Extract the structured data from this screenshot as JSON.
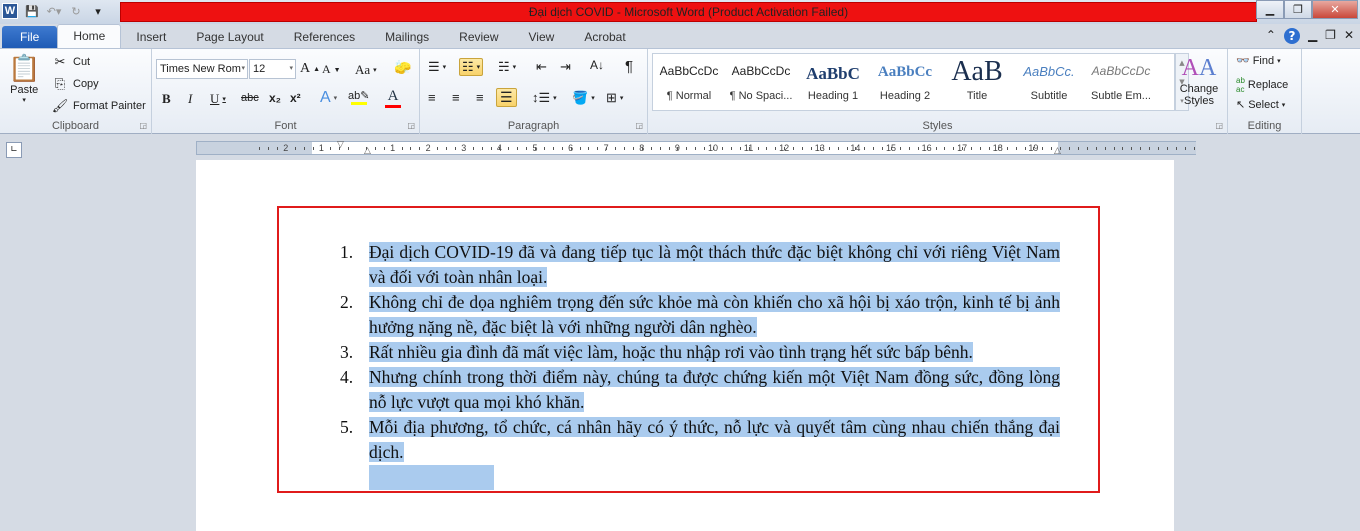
{
  "window": {
    "title": "Đại dịch COVID  -  Microsoft Word (Product Activation Failed)",
    "logo": "W"
  },
  "tabs": [
    "File",
    "Home",
    "Insert",
    "Page Layout",
    "References",
    "Mailings",
    "Review",
    "View",
    "Acrobat"
  ],
  "active_tab": "Home",
  "clipboard": {
    "label": "Clipboard",
    "paste": "Paste",
    "cut": "Cut",
    "copy": "Copy",
    "format_painter": "Format Painter"
  },
  "font": {
    "label": "Font",
    "name": "Times New Rom",
    "size": "12",
    "bold": "B",
    "italic": "I",
    "underline": "U",
    "strike": "abc",
    "sub": "x₂",
    "sup": "x²",
    "case": "Aa",
    "highlight_color": "#ffff00",
    "font_color": "#ff0000"
  },
  "paragraph": {
    "label": "Paragraph",
    "pilcrow": "¶"
  },
  "styles": {
    "label": "Styles",
    "items": [
      {
        "preview": "AaBbCcDc",
        "name": "¶ Normal"
      },
      {
        "preview": "AaBbCcDc",
        "name": "¶ No Spaci..."
      },
      {
        "preview": "AaBbC",
        "name": "Heading 1"
      },
      {
        "preview": "AaBbCc",
        "name": "Heading 2"
      },
      {
        "preview": "AaB",
        "name": "Title"
      },
      {
        "preview": "AaBbCc.",
        "name": "Subtitle"
      },
      {
        "preview": "AaBbCcDc",
        "name": "Subtle Em..."
      }
    ],
    "change_styles": "Change Styles"
  },
  "editing": {
    "label": "Editing",
    "find": "Find",
    "replace": "Replace",
    "select": "Select"
  },
  "ruler": {
    "labels": [
      "2",
      "1",
      "1",
      "2",
      "3",
      "4",
      "5",
      "6",
      "7",
      "8",
      "9",
      "10",
      "11",
      "12",
      "13",
      "14",
      "15",
      "16",
      "17",
      "18",
      "19"
    ]
  },
  "document": {
    "items": [
      {
        "num": "1.",
        "text": "Đại dịch COVID-19 đã và đang tiếp tục là một thách thức đặc biệt không chỉ với riêng Việt Nam và đối với toàn nhân loại."
      },
      {
        "num": "2.",
        "text": "Không chỉ đe dọa nghiêm trọng đến sức khỏe mà còn khiến cho xã hội bị xáo trộn, kinh tế bị ảnh hưởng nặng nề, đặc biệt là với những người dân nghèo."
      },
      {
        "num": "3.",
        "text": "Rất nhiều gia đình đã mất việc làm, hoặc thu nhập rơi vào tình trạng hết sức bấp bênh."
      },
      {
        "num": "4.",
        "text": "Nhưng chính trong thời điểm này, chúng ta được chứng kiến một Việt Nam đồng sức, đồng lòng nỗ lực vượt qua mọi khó khăn."
      },
      {
        "num": "5.",
        "text": "Mỗi địa phương, tổ chức, cá nhân hãy có ý thức, nỗ lực và quyết tâm cùng nhau chiến thắng đại dịch."
      }
    ],
    "selection_color": "#aacbee",
    "highlight_box_color": "#e01b1b"
  }
}
